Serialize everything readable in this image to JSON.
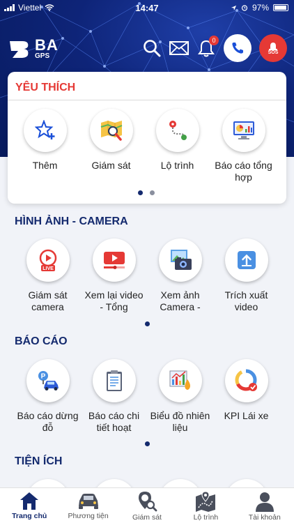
{
  "status_bar": {
    "carrier": "Viettel",
    "time": "14:47",
    "battery": "97%"
  },
  "logo": {
    "brand": "BA",
    "sub": "GPS"
  },
  "header": {
    "notification_count": "0",
    "sos_label": "SOS"
  },
  "favorites": {
    "title": "YÊU THÍCH",
    "items": [
      {
        "label": "Thêm",
        "icon": "star-plus-icon"
      },
      {
        "label": "Giám sát",
        "icon": "map-search-icon"
      },
      {
        "label": "Lộ trình",
        "icon": "route-icon"
      },
      {
        "label": "Báo cáo tổng hợp",
        "icon": "report-chart-icon"
      }
    ]
  },
  "camera": {
    "title": "HÌNH ẢNH - CAMERA",
    "items": [
      {
        "label": "Giám sát camera",
        "icon": "live-camera-icon"
      },
      {
        "label": "Xem lại video - Tổng",
        "icon": "video-play-icon"
      },
      {
        "label": "Xem ảnh Camera -",
        "icon": "photo-camera-icon"
      },
      {
        "label": "Trích xuất video",
        "icon": "export-icon"
      }
    ]
  },
  "reports": {
    "title": "BÁO CÁO",
    "items": [
      {
        "label": "Báo cáo dừng đỗ",
        "icon": "parking-car-icon"
      },
      {
        "label": "Báo cáo chi tiết hoạt",
        "icon": "clipboard-icon"
      },
      {
        "label": "Biểu đồ nhiên liệu",
        "icon": "fuel-chart-icon"
      },
      {
        "label": "KPI Lái xe",
        "icon": "kpi-gauge-icon"
      }
    ]
  },
  "utilities": {
    "title": "TIỆN ÍCH"
  },
  "bottom_nav": [
    {
      "label": "Trang chủ",
      "icon": "home-icon"
    },
    {
      "label": "Phương tiện",
      "icon": "car-icon"
    },
    {
      "label": "Giám sát",
      "icon": "location-search-icon"
    },
    {
      "label": "Lộ trình",
      "icon": "map-route-icon"
    },
    {
      "label": "Tài khoản",
      "icon": "user-icon"
    }
  ],
  "colors": {
    "brand_navy": "#142a6e",
    "accent_red": "#e53935"
  }
}
